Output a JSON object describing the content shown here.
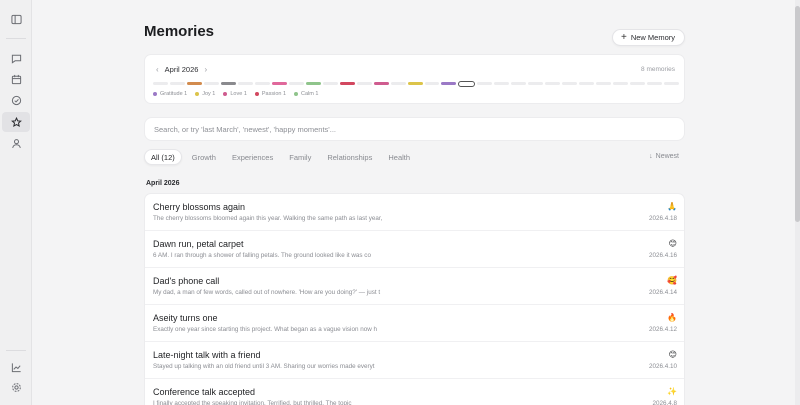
{
  "header": {
    "title": "Memories",
    "new_button_label": "New Memory"
  },
  "timeline": {
    "month_label": "April 2026",
    "count_label": "8 memories",
    "segments": [
      "",
      "",
      "#d28b4e",
      "",
      "#8a8a8e",
      "",
      "",
      "#e0689b",
      "",
      "#8fc48b",
      "",
      "#d2475f",
      "",
      "#cf5c8f",
      "",
      "#dcc44a",
      "",
      "#9b79c6",
      "outline",
      "",
      "",
      "",
      "",
      "",
      "",
      "",
      "",
      "",
      "",
      "",
      ""
    ],
    "legend": [
      {
        "label": "Gratitude 1",
        "color": "#9b79c6"
      },
      {
        "label": "Joy 1",
        "color": "#dcc44a"
      },
      {
        "label": "Love 1",
        "color": "#cf5c8f"
      },
      {
        "label": "Passion 1",
        "color": "#d2475f"
      },
      {
        "label": "Calm 1",
        "color": "#8fc48b"
      }
    ]
  },
  "search": {
    "placeholder": "Search, or try 'last March', 'newest', 'happy moments'..."
  },
  "filters": [
    {
      "label": "All (12)",
      "active": true
    },
    {
      "label": "Growth",
      "active": false
    },
    {
      "label": "Experiences",
      "active": false
    },
    {
      "label": "Family",
      "active": false
    },
    {
      "label": "Relationships",
      "active": false
    },
    {
      "label": "Health",
      "active": false
    }
  ],
  "sort": {
    "label": "Newest"
  },
  "group": {
    "label": "April 2026"
  },
  "memories": [
    {
      "title": "Cherry blossoms again",
      "excerpt": "The cherry blossoms bloomed again this year. Walking the same path as last year,",
      "emoji": "🙏",
      "date": "2026.4.18"
    },
    {
      "title": "Dawn run, petal carpet",
      "excerpt": "6 AM. I ran through a shower of falling petals. The ground looked like it was co",
      "emoji": "😊",
      "date": "2026.4.16"
    },
    {
      "title": "Dad's phone call",
      "excerpt": "My dad, a man of few words, called out of nowhere. 'How are you doing?' — just t",
      "emoji": "🥰",
      "date": "2026.4.14"
    },
    {
      "title": "Aseity turns one",
      "excerpt": "Exactly one year since starting this project. What began as a vague vision now h",
      "emoji": "🔥",
      "date": "2026.4.12"
    },
    {
      "title": "Late-night talk with a friend",
      "excerpt": "Stayed up talking with an old friend until 3 AM. Sharing our worries made everyt",
      "emoji": "😊",
      "date": "2026.4.10"
    },
    {
      "title": "Conference talk accepted",
      "excerpt": "I finally accepted the speaking invitation. Terrified, but thrilled. The topic",
      "emoji": "✨",
      "date": "2026.4.8"
    }
  ]
}
